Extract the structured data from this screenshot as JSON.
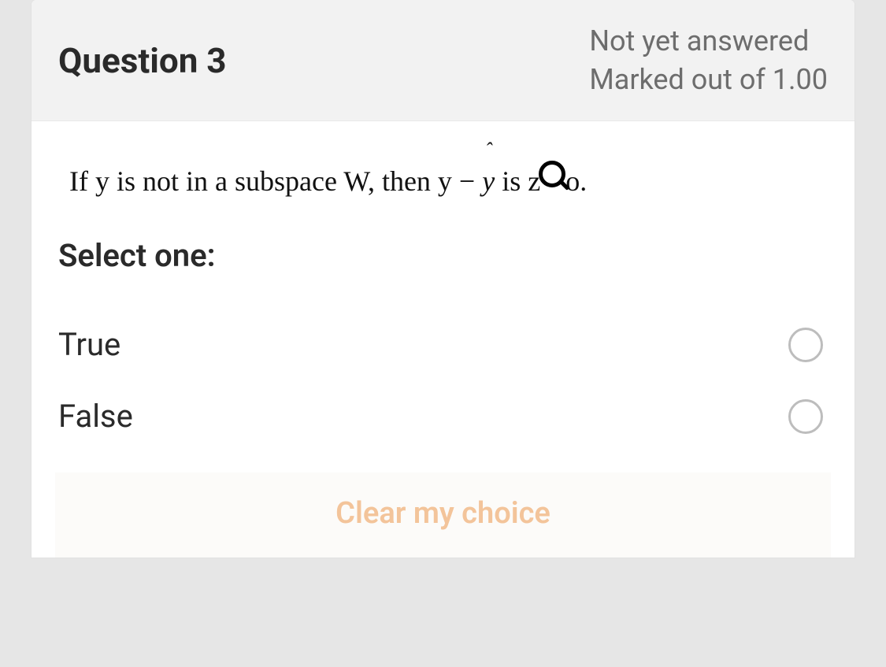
{
  "header": {
    "title": "Question 3",
    "status": "Not yet answered",
    "marks": "Marked out of 1.00"
  },
  "body": {
    "stem_prefix": "If y is not in a subspace W, then y  −  ",
    "stem_yhat": "ŷ",
    "stem_suffix_a": " is z",
    "stem_suffix_b": "o.",
    "prompt": "Select one:",
    "options": [
      {
        "label": "True",
        "selected": false
      },
      {
        "label": "False",
        "selected": false
      }
    ],
    "clear": "Clear my choice"
  }
}
